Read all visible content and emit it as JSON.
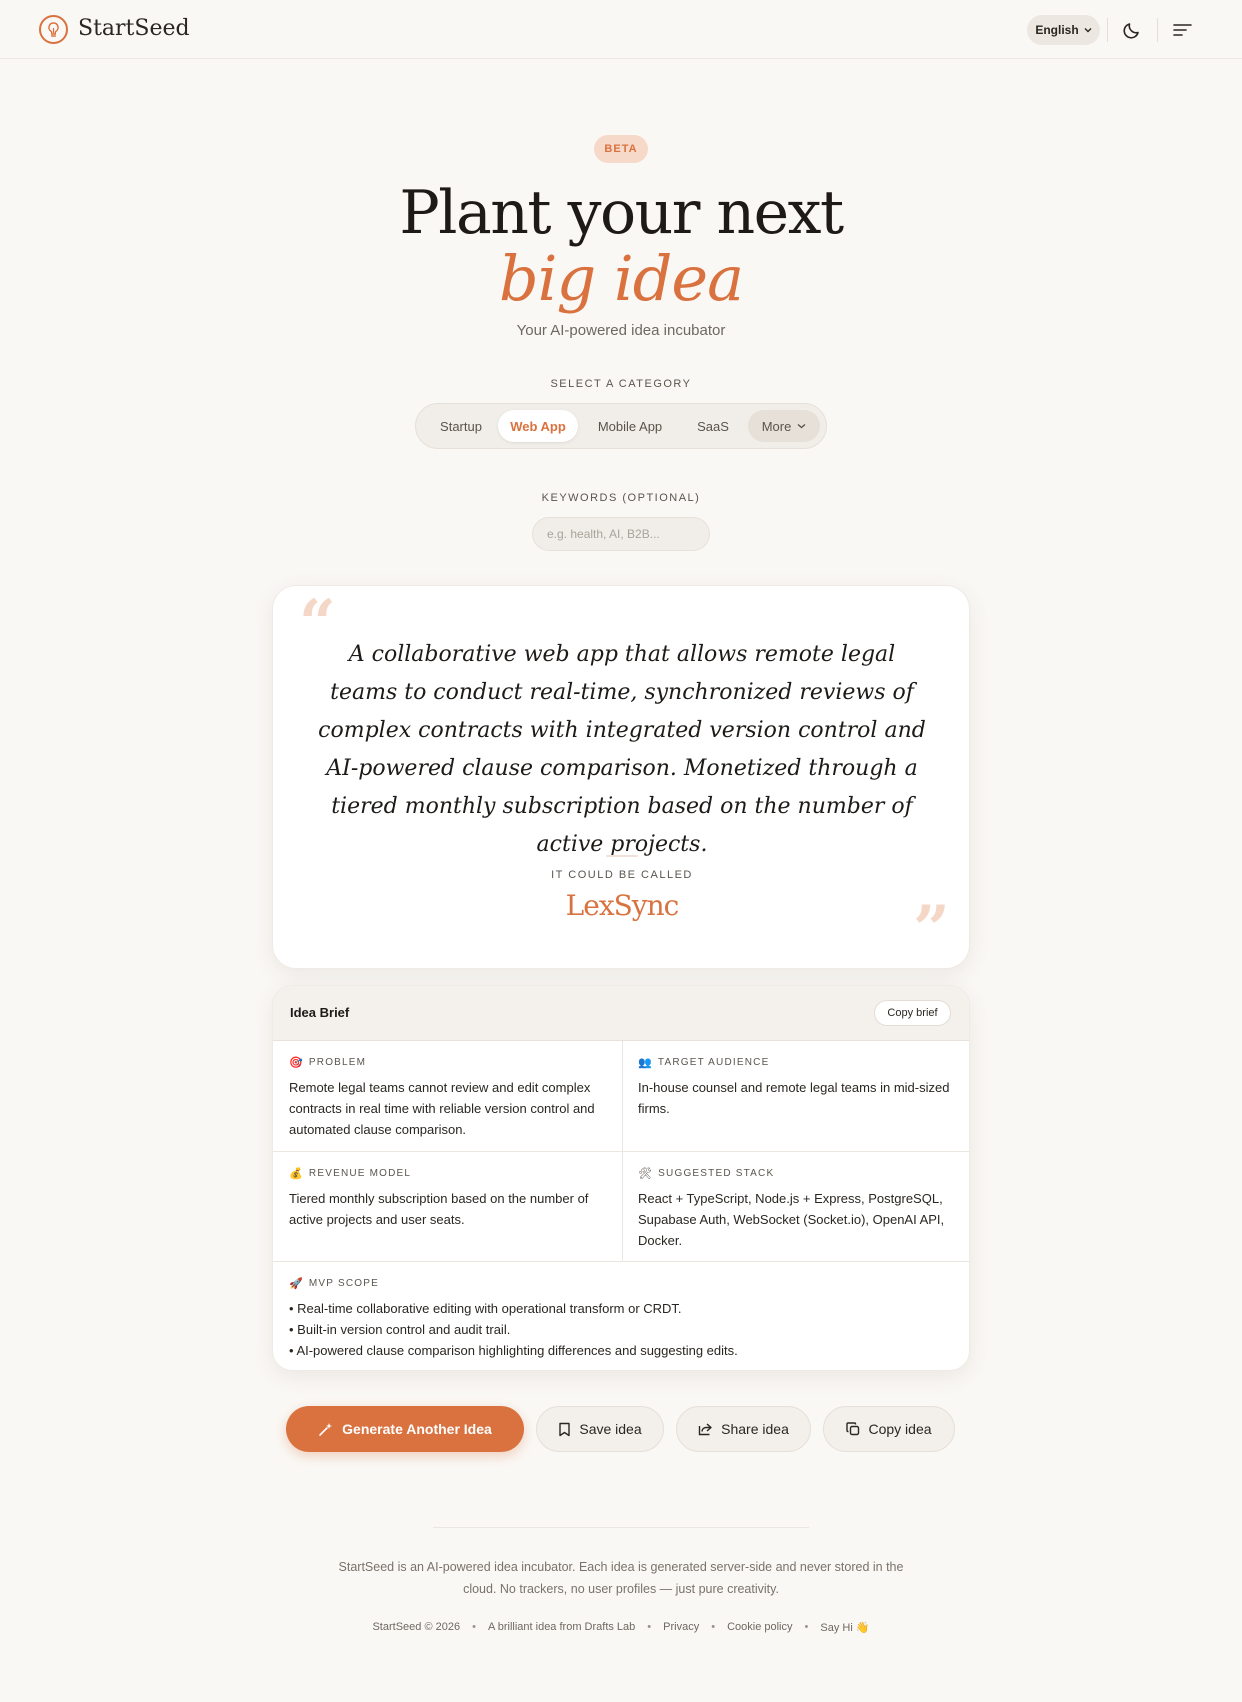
{
  "header": {
    "brand": "StartSeed",
    "language": "English"
  },
  "hero": {
    "badge": "BETA",
    "title_line1": "Plant your next",
    "title_line2": "big idea",
    "subtitle": "Your AI-powered idea incubator"
  },
  "category": {
    "label": "SELECT A CATEGORY",
    "options": [
      "Startup",
      "Web App",
      "Mobile App",
      "SaaS"
    ],
    "more": "More",
    "selected": "Web App"
  },
  "keywords": {
    "label": "KEYWORDS (OPTIONAL)",
    "placeholder": "e.g. health, AI, B2B...",
    "value": ""
  },
  "idea": {
    "quote": "A collaborative web app that allows remote legal teams to conduct real-time, synchronized reviews of complex contracts with integrated version control and AI-powered clause comparison. Monetized through a tiered monthly subscription based on the number of active projects.",
    "called_label": "IT COULD BE CALLED",
    "name": "LexSync"
  },
  "brief": {
    "title": "Idea Brief",
    "copy_label": "Copy brief",
    "problem": {
      "icon": "🎯",
      "title": "PROBLEM",
      "text": "Remote legal teams cannot review and edit complex contracts in real time with reliable version control and automated clause comparison."
    },
    "audience": {
      "icon": "👥",
      "title": "TARGET AUDIENCE",
      "text": "In-house counsel and remote legal teams in mid-sized firms."
    },
    "revenue": {
      "icon": "💰",
      "title": "REVENUE MODEL",
      "text": "Tiered monthly subscription based on the number of active projects and user seats."
    },
    "stack": {
      "icon": "🛠",
      "title": "SUGGESTED STACK",
      "text": "React + TypeScript, Node.js + Express, PostgreSQL, Supabase Auth, WebSocket (Socket.io), OpenAI API, Docker."
    },
    "mvp": {
      "icon": "🚀",
      "title": "MVP SCOPE",
      "items": [
        "• Real-time collaborative editing with operational transform or CRDT.",
        "• Built-in version control and audit trail.",
        "• AI-powered clause comparison highlighting differences and suggesting edits."
      ]
    }
  },
  "actions": {
    "generate": "Generate Another Idea",
    "save": "Save idea",
    "share": "Share idea",
    "copy": "Copy idea"
  },
  "footer": {
    "description": "StartSeed is an AI-powered idea incubator. Each idea is generated server-side and never stored in the cloud. No trackers, no user profiles — just pure creativity.",
    "copyright": "StartSeed © 2026",
    "credit": "A brilliant idea from Drafts Lab",
    "privacy": "Privacy",
    "cookie": "Cookie policy",
    "say_hi": "Say Hi 👋"
  },
  "colors": {
    "accent": "#d9723f",
    "background": "#faf8f5"
  }
}
